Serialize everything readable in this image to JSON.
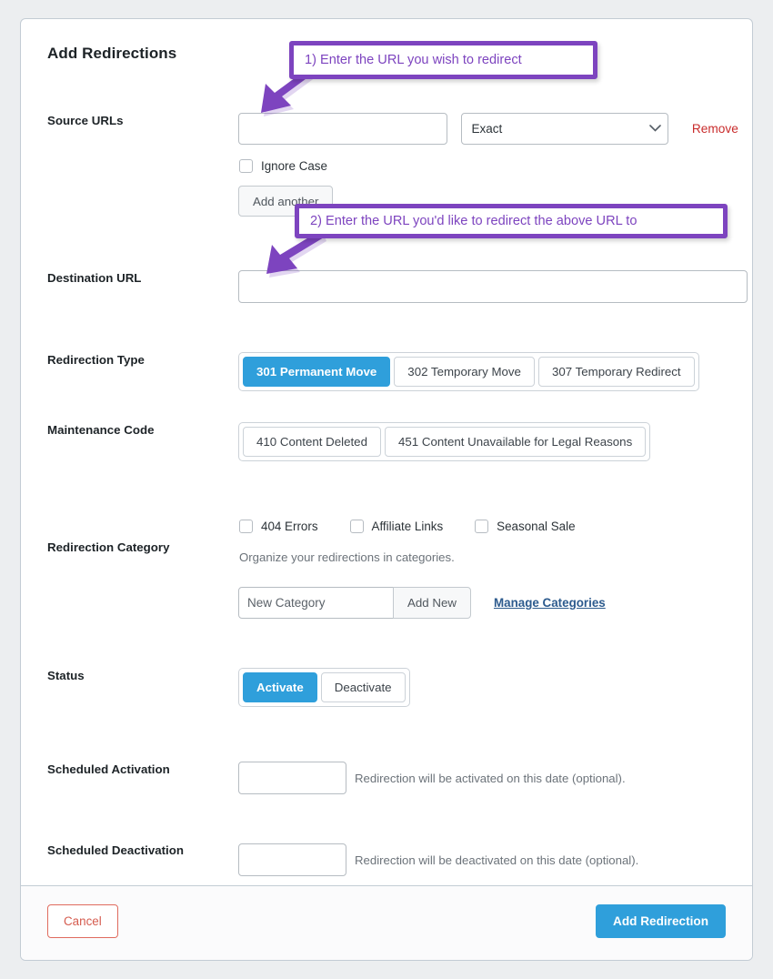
{
  "card": {
    "title": "Add Redirections"
  },
  "annotations": [
    {
      "id": "callout-1",
      "text": "1) Enter the URL you wish to redirect"
    },
    {
      "id": "callout-2",
      "text": "2) Enter the URL you'd like to redirect the above URL to"
    }
  ],
  "source_urls": {
    "label": "Source URLs",
    "url_value": "",
    "url_placeholder": "",
    "match_selected": "Exact",
    "match_options": [
      "Exact"
    ],
    "remove_label": "Remove",
    "ignore_case_label": "Ignore Case",
    "ignore_case_checked": false,
    "add_another_label": "Add another"
  },
  "destination": {
    "label": "Destination URL",
    "value": "",
    "placeholder": ""
  },
  "redirection_type": {
    "label": "Redirection Type",
    "options": [
      {
        "label": "301 Permanent Move",
        "active": true
      },
      {
        "label": "302 Temporary Move",
        "active": false
      },
      {
        "label": "307 Temporary Redirect",
        "active": false
      }
    ]
  },
  "maintenance_code": {
    "label": "Maintenance Code",
    "options": [
      {
        "label": "410 Content Deleted",
        "active": false
      },
      {
        "label": "451 Content Unavailable for Legal Reasons",
        "active": false
      }
    ]
  },
  "redirection_category": {
    "label": "Redirection Category",
    "checkboxes": [
      {
        "label": "404 Errors",
        "checked": false
      },
      {
        "label": "Affiliate Links",
        "checked": false
      },
      {
        "label": "Seasonal Sale",
        "checked": false
      }
    ],
    "help": "Organize your redirections in categories.",
    "new_category_value": "",
    "new_category_placeholder": "New Category",
    "add_new_label": "Add New",
    "manage_categories_label": "Manage Categories"
  },
  "status": {
    "label": "Status",
    "options": [
      {
        "label": "Activate",
        "active": true
      },
      {
        "label": "Deactivate",
        "active": false
      }
    ]
  },
  "scheduled_activation": {
    "label": "Scheduled Activation",
    "value": "",
    "placeholder": "",
    "help": "Redirection will be activated on this date (optional)."
  },
  "scheduled_deactivation": {
    "label": "Scheduled Deactivation",
    "value": "",
    "placeholder": "",
    "help": "Redirection will be deactivated on this date (optional)."
  },
  "footer": {
    "cancel_label": "Cancel",
    "submit_label": "Add Redirection"
  },
  "colors": {
    "accent_blue": "#2f9fdb",
    "annotation_purple": "#7d44bf",
    "danger_red": "#c92c2c",
    "cancel_red": "#d55c4f",
    "link_blue": "#2d5b8e",
    "page_bg": "#eceef0"
  }
}
